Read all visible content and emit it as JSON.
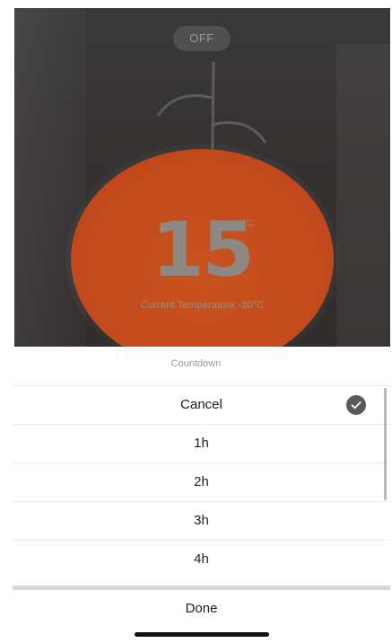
{
  "background": {
    "power_toggle_label": "OFF",
    "temperature_value": "15",
    "temperature_unit": "°C",
    "current_temperature_text": "Current Temperature -20°C",
    "dial_color": "#c44b1c"
  },
  "countdown_sheet": {
    "title": "Countdown",
    "options": [
      {
        "label": "Cancel",
        "selected": true
      },
      {
        "label": "1h",
        "selected": false
      },
      {
        "label": "2h",
        "selected": false
      },
      {
        "label": "3h",
        "selected": false
      },
      {
        "label": "4h",
        "selected": false
      }
    ],
    "selected_icon": "checkmark-icon",
    "done_label": "Done"
  }
}
